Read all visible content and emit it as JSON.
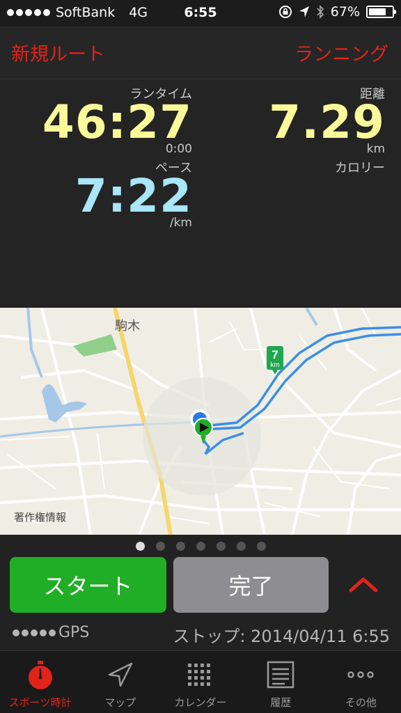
{
  "status_bar": {
    "carrier": "SoftBank",
    "network": "4G",
    "time": "6:55",
    "battery": "67%"
  },
  "nav": {
    "left_button": "新規ルート",
    "right_button": "ランニング"
  },
  "stats": {
    "run_time_label": "ランタイム",
    "run_time": "46:27",
    "run_time_sub": "0:00",
    "distance_label": "距離",
    "distance": "7.29",
    "distance_unit": "km",
    "pace_label": "ペース",
    "pace": "7:22",
    "pace_unit": "/km",
    "calorie_label": "カロリー"
  },
  "map": {
    "place_label": "駒木",
    "copyright": "著作権情報",
    "km_marker": "7",
    "km_marker_unit": "km"
  },
  "pager": {
    "count": 7,
    "active_index": 0
  },
  "controls": {
    "start_label": "スタート",
    "done_label": "完了",
    "gps_label": "GPS",
    "stop_info": "ストップ: 2014/04/11 6:55"
  },
  "tabs": [
    {
      "label": "スポーツ時計",
      "icon": "stopwatch-icon",
      "active": true
    },
    {
      "label": "マップ",
      "icon": "location-arrow-icon",
      "active": false
    },
    {
      "label": "カレンダー",
      "icon": "calendar-grid-icon",
      "active": false
    },
    {
      "label": "履歴",
      "icon": "history-list-icon",
      "active": false
    },
    {
      "label": "その他",
      "icon": "more-dots-icon",
      "active": false
    }
  ],
  "colors": {
    "accent": "#e2231a",
    "time_value": "#fafa9a",
    "pace_value": "#a8e6f8",
    "start_button": "#1fae25",
    "done_button": "#8d8d92",
    "route": "#3b8fe6"
  }
}
